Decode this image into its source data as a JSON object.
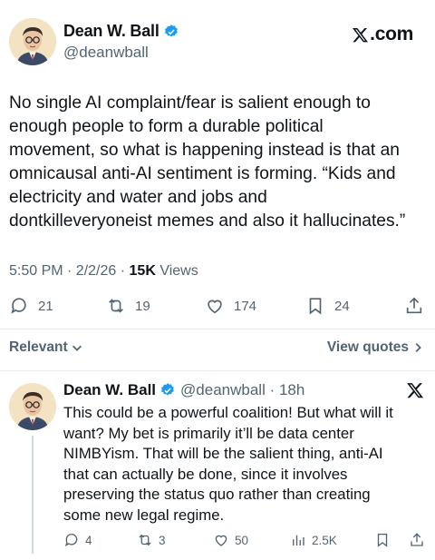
{
  "post": {
    "author_name": "Dean W. Ball",
    "handle": "@deanwball",
    "brand": ".com",
    "text": "No single AI complaint/fear is salient enough to\nenough people to form a durable political\nmovement, so what is happening instead is that an\nomnicausal anti-AI sentiment is forming. “Kids and\nelectricity and water and jobs and\ndontkilleveryoneist memes and also it hallucinates.”",
    "time": "5:50 PM · 2/2/26 · ",
    "views_count": "15K",
    "views_label": " Views",
    "stats": {
      "replies": "21",
      "reposts": "19",
      "likes": "174",
      "bookmarks": "24"
    }
  },
  "sort": {
    "relevant_label": "Relevant",
    "view_quotes_label": "View quotes"
  },
  "reply": {
    "author_name": "Dean W. Ball",
    "handle_time": "@deanwball · 18h",
    "text": "This could be a powerful coalition! But what will it\nwant? My bet is primarily it’ll be  data center\nNIMBYism. That will be the salient thing, anti-AI\nthat can actually be done, since it involves\npreserving the status quo rather than creating\nsome new legal regime.",
    "stats": {
      "replies": "4",
      "reposts": "3",
      "likes": "50",
      "views": "2.5K"
    }
  },
  "colors": {
    "verified": "#1d9bf0",
    "text": "#0f1419",
    "secondary": "#536471"
  },
  "icons": [
    "verified-badge-icon",
    "x-logo-icon",
    "reply-icon",
    "repost-icon",
    "like-icon",
    "bookmark-icon",
    "share-icon",
    "views-icon",
    "chevron-down-icon",
    "chevron-right-icon"
  ]
}
